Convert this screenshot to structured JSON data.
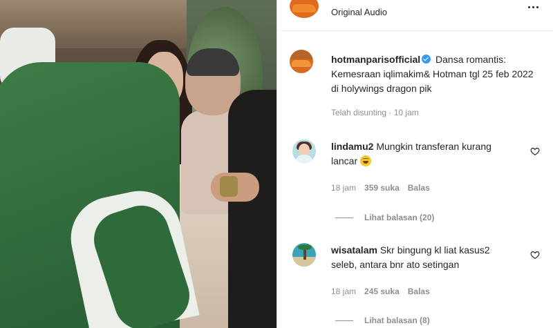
{
  "header": {
    "audio_label": "Original Audio"
  },
  "caption": {
    "username": "hotmanparisofficial",
    "text": "Dansa romantis: Kemesraan iqlimakim& Hotman tgl 25 feb 2022 di holywings dragon pik",
    "edited_label": "Telah disunting",
    "separator": "·",
    "time": "10 jam"
  },
  "comments": [
    {
      "username": "lindamu2",
      "text": "Mungkin transferan kurang lancar",
      "emoji": "grinning-face",
      "time": "18 jam",
      "likes": "359 suka",
      "reply_label": "Balas",
      "view_replies": "Lihat balasan (20)"
    },
    {
      "username": "wisatalam",
      "text": "Skr bingung kl liat kasus2 seleb, antara bnr ato setingan",
      "time": "18 jam",
      "likes": "245 suka",
      "reply_label": "Balas",
      "view_replies": "Lihat balasan (8)"
    }
  ],
  "colors": {
    "verified": "#3897f0",
    "secondary_text": "#8e8e8e",
    "primary_text": "#262626"
  }
}
